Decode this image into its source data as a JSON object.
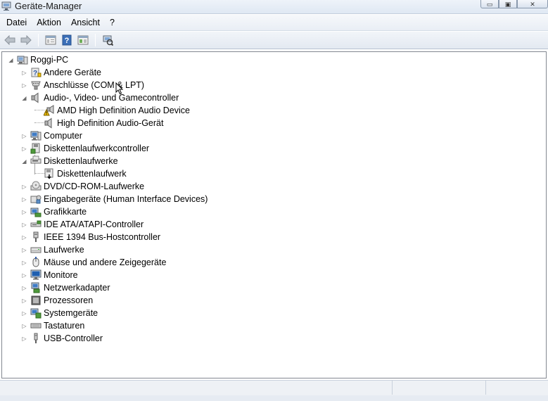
{
  "window": {
    "title": "Geräte-Manager",
    "controls": {
      "minimize": "▭",
      "maximize": "▣",
      "close": "✕"
    }
  },
  "menu": [
    "Datei",
    "Aktion",
    "Ansicht",
    "?"
  ],
  "toolbar": {
    "buttons": [
      "back-arrow-icon",
      "forward-arrow-icon",
      "properties-icon",
      "help-icon",
      "view-icon",
      "scan-hardware-icon"
    ]
  },
  "tree": {
    "root": "Roggi-PC",
    "categories": [
      {
        "label": "Andere Geräte",
        "expanded": false,
        "icon": "unknown-device-icon"
      },
      {
        "label": "Anschlüsse (COM & LPT)",
        "expanded": false,
        "icon": "port-icon"
      },
      {
        "label": "Audio-, Video- und Gamecontroller",
        "expanded": true,
        "icon": "speaker-icon",
        "children": [
          {
            "label": "AMD High Definition Audio Device",
            "icon": "speaker-warning-icon"
          },
          {
            "label": "High Definition Audio-Gerät",
            "icon": "speaker-icon"
          }
        ]
      },
      {
        "label": "Computer",
        "expanded": false,
        "icon": "computer-icon"
      },
      {
        "label": "Diskettenlaufwerkcontroller",
        "expanded": false,
        "icon": "floppy-controller-icon"
      },
      {
        "label": "Diskettenlaufwerke",
        "expanded": true,
        "icon": "floppy-drive-icon",
        "children": [
          {
            "label": "Diskettenlaufwerk",
            "icon": "floppy-drive-disabled-icon"
          }
        ]
      },
      {
        "label": "DVD/CD-ROM-Laufwerke",
        "expanded": false,
        "icon": "dvd-drive-icon"
      },
      {
        "label": "Eingabegeräte (Human Interface Devices)",
        "expanded": false,
        "icon": "hid-icon"
      },
      {
        "label": "Grafikkarte",
        "expanded": false,
        "icon": "display-adapter-icon"
      },
      {
        "label": "IDE ATA/ATAPI-Controller",
        "expanded": false,
        "icon": "ide-controller-icon"
      },
      {
        "label": "IEEE 1394 Bus-Hostcontroller",
        "expanded": false,
        "icon": "firewire-icon"
      },
      {
        "label": "Laufwerke",
        "expanded": false,
        "icon": "disk-drive-icon"
      },
      {
        "label": "Mäuse und andere Zeigegeräte",
        "expanded": false,
        "icon": "mouse-icon"
      },
      {
        "label": "Monitore",
        "expanded": false,
        "icon": "monitor-icon"
      },
      {
        "label": "Netzwerkadapter",
        "expanded": false,
        "icon": "network-adapter-icon"
      },
      {
        "label": "Prozessoren",
        "expanded": false,
        "icon": "processor-icon"
      },
      {
        "label": "Systemgeräte",
        "expanded": false,
        "icon": "system-device-icon"
      },
      {
        "label": "Tastaturen",
        "expanded": false,
        "icon": "keyboard-icon"
      },
      {
        "label": "USB-Controller",
        "expanded": false,
        "icon": "usb-icon"
      }
    ]
  },
  "colors": {
    "titlebar": "#dfe8f3",
    "menubar": "#e9eef5",
    "border": "#828790",
    "warning": "#f5c400"
  }
}
